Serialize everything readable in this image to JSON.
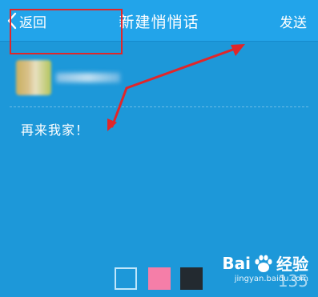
{
  "header": {
    "back_label": "返回",
    "title": "新建悄悄话",
    "send_label": "发送"
  },
  "message": {
    "text": "再来我家！"
  },
  "color_options": [
    {
      "name": "blue",
      "color": "#1d98d9"
    },
    {
      "name": "pink",
      "color": "#f57ea8"
    },
    {
      "name": "black",
      "color": "#232a30"
    }
  ],
  "annotation": {
    "color": "#e0262a"
  },
  "watermark": {
    "brand_text": "经验",
    "url_text": "jingyan.baidu.com",
    "number_text": "135"
  }
}
